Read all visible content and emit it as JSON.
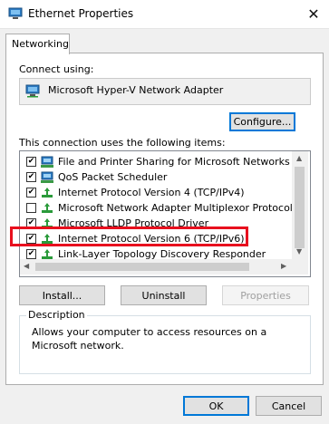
{
  "window": {
    "title": "Ethernet Properties",
    "close_glyph": "✕",
    "title_icon": "network-adapter-icon"
  },
  "tabs": [
    {
      "label": "Networking",
      "selected": true
    }
  ],
  "connect": {
    "label": "Connect using:",
    "adapter": "Microsoft Hyper-V Network Adapter",
    "adapter_icon": "network-adapter-icon"
  },
  "buttons": {
    "configure": "Configure...",
    "install": "Install...",
    "uninstall": "Uninstall",
    "properties": "Properties",
    "ok": "OK",
    "cancel": "Cancel"
  },
  "items_label": "This connection uses the following items:",
  "items": [
    {
      "label": "File and Printer Sharing for Microsoft Networks",
      "checked": true,
      "icon": "network-client-icon"
    },
    {
      "label": "QoS Packet Scheduler",
      "checked": true,
      "icon": "network-client-icon"
    },
    {
      "label": "Internet Protocol Version 4 (TCP/IPv4)",
      "checked": true,
      "icon": "protocol-icon"
    },
    {
      "label": "Microsoft Network Adapter Multiplexor Protocol",
      "checked": false,
      "icon": "protocol-icon"
    },
    {
      "label": "Microsoft LLDP Protocol Driver",
      "checked": true,
      "icon": "protocol-icon"
    },
    {
      "label": "Internet Protocol Version 6 (TCP/IPv6)",
      "checked": true,
      "icon": "protocol-icon",
      "highlighted": true
    },
    {
      "label": "Link-Layer Topology Discovery Responder",
      "checked": true,
      "icon": "protocol-icon"
    }
  ],
  "description": {
    "title": "Description",
    "text": "Allows your computer to access resources on a Microsoft network."
  },
  "colors": {
    "highlight_box": "#e8101e",
    "accent": "#0078d7"
  }
}
